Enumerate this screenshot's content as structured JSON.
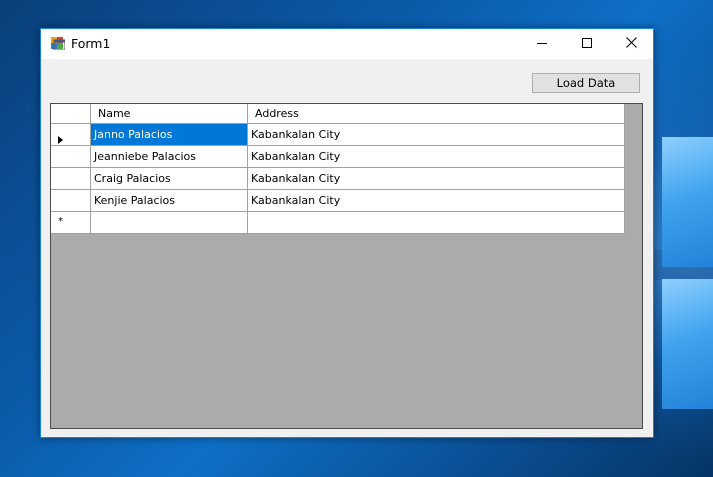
{
  "window": {
    "title": "Form1",
    "icon": "winforms-app-icon",
    "controls": {
      "minimize": "minimize-icon",
      "maximize": "maximize-icon",
      "close": "close-icon"
    }
  },
  "toolbar": {
    "load_label": "Load Data"
  },
  "grid": {
    "columns": [
      "Name",
      "Address"
    ],
    "rows": [
      {
        "name": "Janno Palacios",
        "address": "Kabankalan City",
        "selected": true,
        "current": true
      },
      {
        "name": "Jeanniebe Palacios",
        "address": "Kabankalan City"
      },
      {
        "name": "Craig Palacios",
        "address": "Kabankalan City"
      },
      {
        "name": "Kenjie Palacios",
        "address": "Kabankalan City"
      }
    ],
    "new_row_marker": "*"
  },
  "colors": {
    "selection": "#0078d7",
    "grid_background": "#ababab",
    "window_border": "#1883d7"
  }
}
